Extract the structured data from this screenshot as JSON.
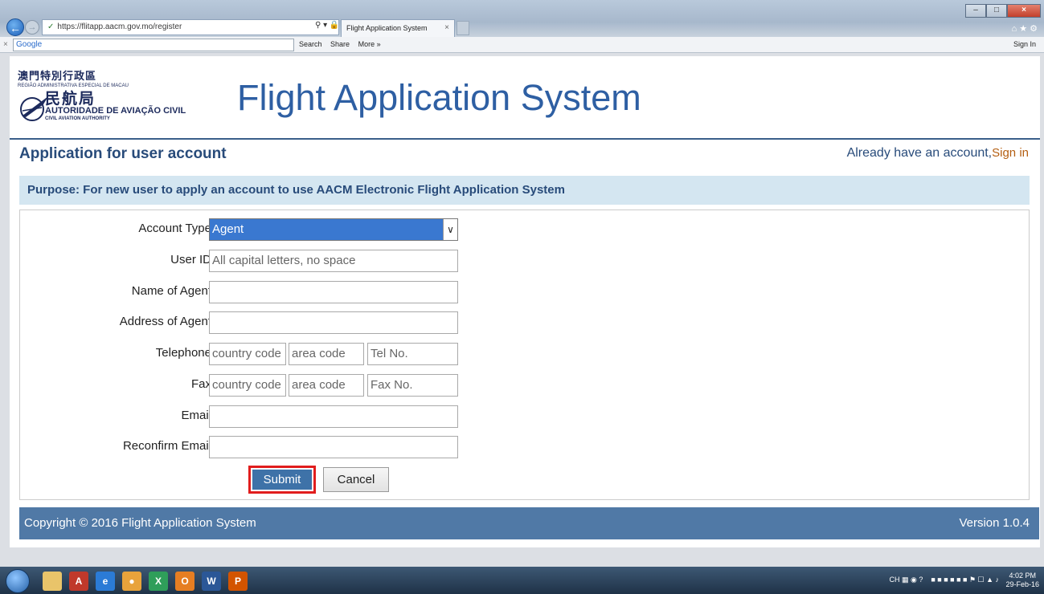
{
  "browser": {
    "url": "https://flitapp.aacm.gov.mo/register",
    "tab_title": "Flight Application System",
    "search_label": "Google",
    "toolbar_items": [
      "Search",
      "Share",
      "More »"
    ],
    "sign_in": "Sign In"
  },
  "header": {
    "logo_line1": "澳門特別行政區",
    "logo_line2": "REGIÃO ADMINISTRATIVA ESPECIAL DE MACAU",
    "logo_line3": "民航局",
    "logo_line4": "AUTORIDADE DE AVIAÇÃO CIVIL",
    "logo_line5": "CIVIL AVIATION AUTHORITY",
    "title": "Flight Application System"
  },
  "page": {
    "section_title": "Application for user account",
    "account_prompt": "Already have an account,",
    "sign_in_link": "Sign in",
    "purpose": "Purpose: For new user to apply an account to use AACM Electronic Flight Application System"
  },
  "form": {
    "account_type": {
      "label": "Account Type",
      "value": "Agent"
    },
    "user_id": {
      "label": "User ID",
      "placeholder": "All capital letters, no space"
    },
    "name": {
      "label": "Name of Agent",
      "value": ""
    },
    "address": {
      "label": "Address of Agent",
      "value": ""
    },
    "telephone": {
      "label": "Telephone",
      "country_placeholder": "country code",
      "area_placeholder": "area code",
      "number_placeholder": "Tel No."
    },
    "fax": {
      "label": "Fax",
      "country_placeholder": "country code",
      "area_placeholder": "area code",
      "number_placeholder": "Fax No."
    },
    "email": {
      "label": "Email",
      "value": ""
    },
    "reconfirm_email": {
      "label": "Reconfirm Email",
      "value": ""
    },
    "submit_label": "Submit",
    "cancel_label": "Cancel"
  },
  "footer": {
    "copyright": "Copyright © 2016 Flight Application System",
    "version": "Version 1.0.4"
  },
  "taskbar": {
    "lang": "CH",
    "time": "4:02 PM",
    "date": "29-Feb-16"
  },
  "colors": {
    "accent": "#2e5fa3",
    "header_text": "#284b7a",
    "purpose_bg": "#d4e6f1",
    "footer_bg": "#5079a6",
    "submit_bg": "#3e72a8",
    "highlight": "#e11d1d",
    "select_bg": "#3a78d0"
  }
}
